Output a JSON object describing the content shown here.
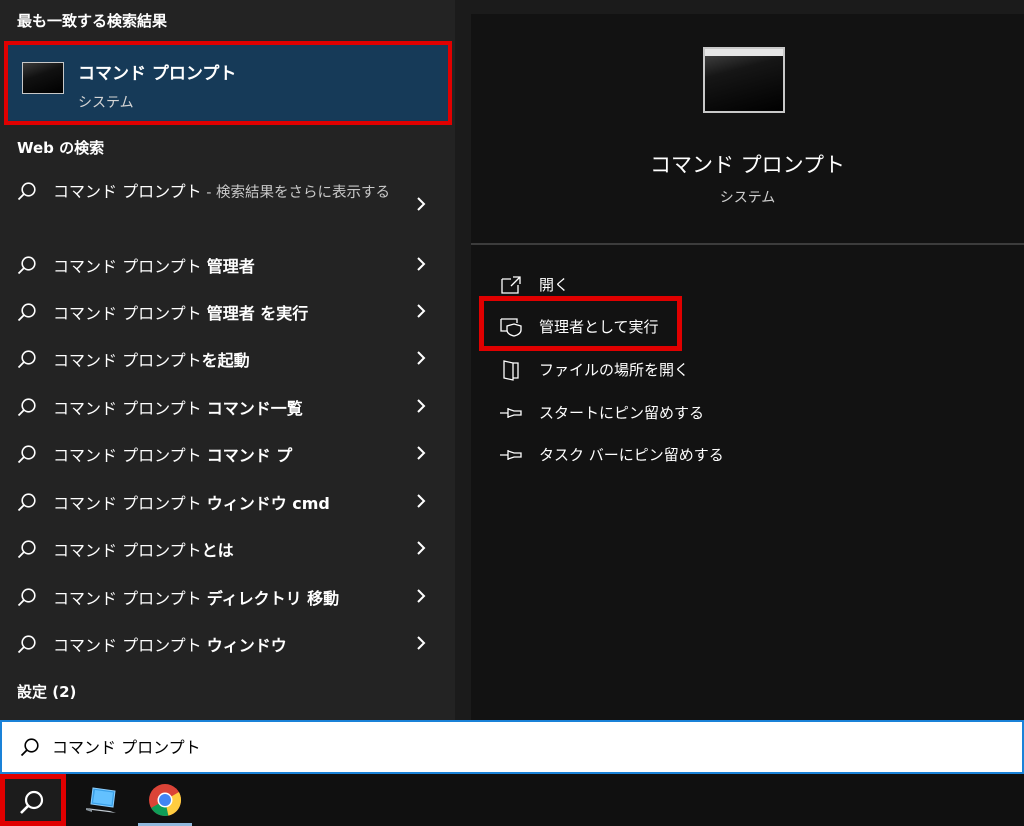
{
  "left_panel": {
    "best_match_header": "最も一致する検索結果",
    "best_match": {
      "title": "コマンド プロンプト",
      "subtitle": "システム"
    },
    "web_header": "Web の検索",
    "web_results": [
      {
        "prefix": "コマンド プロンプト",
        "suffix": " - 検索結果をさらに表示する"
      },
      {
        "prefix": "コマンド プロンプト ",
        "suffix": "管理者"
      },
      {
        "prefix": "コマンド プロンプト ",
        "suffix": "管理者 を実行"
      },
      {
        "prefix": "コマンド プロンプト",
        "suffix": "を起動"
      },
      {
        "prefix": "コマンド プロンプト ",
        "suffix": "コマンド一覧"
      },
      {
        "prefix": "コマンド プロンプト ",
        "suffix": "コマンド プ"
      },
      {
        "prefix": "コマンド プロンプト ",
        "suffix": "ウィンドウ cmd"
      },
      {
        "prefix": "コマンド プロンプト",
        "suffix": "とは"
      },
      {
        "prefix": "コマンド プロンプト ",
        "suffix": "ディレクトリ 移動"
      },
      {
        "prefix": "コマンド プロンプト ",
        "suffix": "ウィンドウ"
      }
    ],
    "settings_header": "設定 (2)"
  },
  "right_panel": {
    "app_title": "コマンド プロンプト",
    "app_subtitle": "システム",
    "actions": [
      {
        "icon": "open-icon",
        "label": "開く"
      },
      {
        "icon": "admin-shield-icon",
        "label": "管理者として実行"
      },
      {
        "icon": "file-location-icon",
        "label": "ファイルの場所を開く"
      },
      {
        "icon": "pin-icon",
        "label": "スタートにピン留めする"
      },
      {
        "icon": "pin-icon",
        "label": "タスク バーにピン留めする"
      }
    ]
  },
  "search": {
    "value": "コマンド プロンプト"
  },
  "colors": {
    "highlight_red": "#e00000",
    "selected_bg": "#163a58",
    "search_border": "#1a82d8"
  }
}
